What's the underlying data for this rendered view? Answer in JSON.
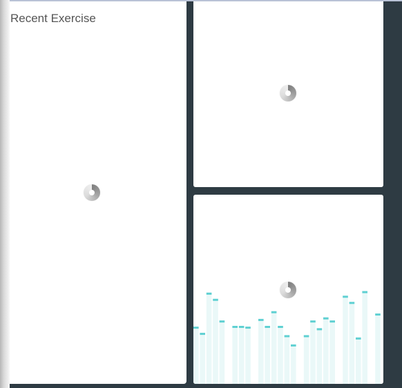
{
  "recent_exercise": {
    "title": "Recent Exercise"
  },
  "loading": {
    "icon": "loading-spinner-icon"
  },
  "colors": {
    "background": "#2e3b43",
    "card": "#ffffff",
    "bar_fill": "#eaf8f8",
    "bar_cap": "#5fd0d2"
  },
  "chart_data": {
    "type": "bar",
    "values": [
      74,
      66,
      118,
      110,
      82,
      null,
      75,
      75,
      74,
      null,
      84,
      75,
      94,
      75,
      63,
      51,
      null,
      63,
      82,
      72,
      86,
      82,
      null,
      114,
      106,
      60,
      120,
      null,
      91
    ]
  }
}
